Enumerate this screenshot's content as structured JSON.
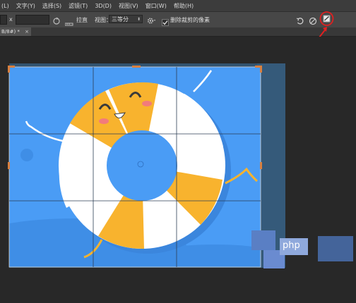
{
  "menu": {
    "items": [
      "(L)",
      "文字(Y)",
      "选择(S)",
      "滤镜(T)",
      "3D(D)",
      "视图(V)",
      "窗口(W)",
      "帮助(H)"
    ]
  },
  "options": {
    "field_x_label": "x",
    "straighten_label": "拉直",
    "view_label": "视图：",
    "view_value": "三等分",
    "delete_cropped_label": "删除裁剪的像素",
    "delete_cropped_checked": true
  },
  "document": {
    "tab_label": "B/8#) *",
    "tab_close": "×"
  },
  "watermark": {
    "text": "php"
  },
  "colors": {
    "menubar": "#3c3c3c",
    "optionsbar": "#474747",
    "canvas_bg": "#282828",
    "artwork_blue": "#4a9cf5",
    "ring_yellow": "#f8b32e",
    "highlight_red": "#e02020"
  },
  "icons": {
    "rotate": "rotate-icon",
    "settings": "gear-icon",
    "undo": "undo-icon",
    "cancel": "cancel-icon",
    "commit": "commit-check-icon"
  }
}
